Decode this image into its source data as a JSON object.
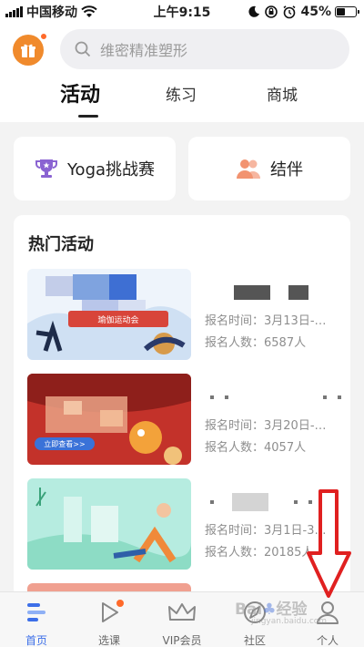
{
  "status_bar": {
    "carrier": "中国移动",
    "time": "上午9:15",
    "battery": "45%",
    "battery_level": 0.45
  },
  "header": {
    "search_placeholder": "维密精准塑形",
    "tabs": [
      {
        "label": "活动",
        "active": true
      },
      {
        "label": "练习",
        "active": false
      },
      {
        "label": "商城",
        "active": false
      }
    ]
  },
  "quick_cards": [
    {
      "label": "Yoga挑战赛",
      "icon": "trophy-icon",
      "color": "#8a63d2"
    },
    {
      "label": "结伴",
      "icon": "people-icon",
      "color": "#f29370"
    }
  ],
  "hot_section": {
    "title": "热门活动",
    "activities": [
      {
        "banner_text": "瑜伽运动会",
        "time": "报名时间：3月13日-…",
        "count": "报名人数：6587人"
      },
      {
        "banner_text": "立即查看>>",
        "time": "报名时间：3月20日-…",
        "count": "报名人数：4057人"
      },
      {
        "banner_text": "",
        "time": "报名时间：3月1日-3…",
        "count": "报名人数：20185人"
      }
    ]
  },
  "bottom_nav": [
    {
      "label": "首页",
      "icon": "home-icon",
      "active": true
    },
    {
      "label": "选课",
      "icon": "play-icon",
      "active": false
    },
    {
      "label": "VIP会员",
      "icon": "crown-icon",
      "active": false
    },
    {
      "label": "社区",
      "icon": "compass-icon",
      "active": false
    },
    {
      "label": "个人",
      "icon": "user-icon",
      "active": false
    }
  ],
  "colors": {
    "accent": "#3d6fe8",
    "gift": "#f08a2c",
    "badge": "#ff6a2a",
    "annotation": "#e02020"
  }
}
